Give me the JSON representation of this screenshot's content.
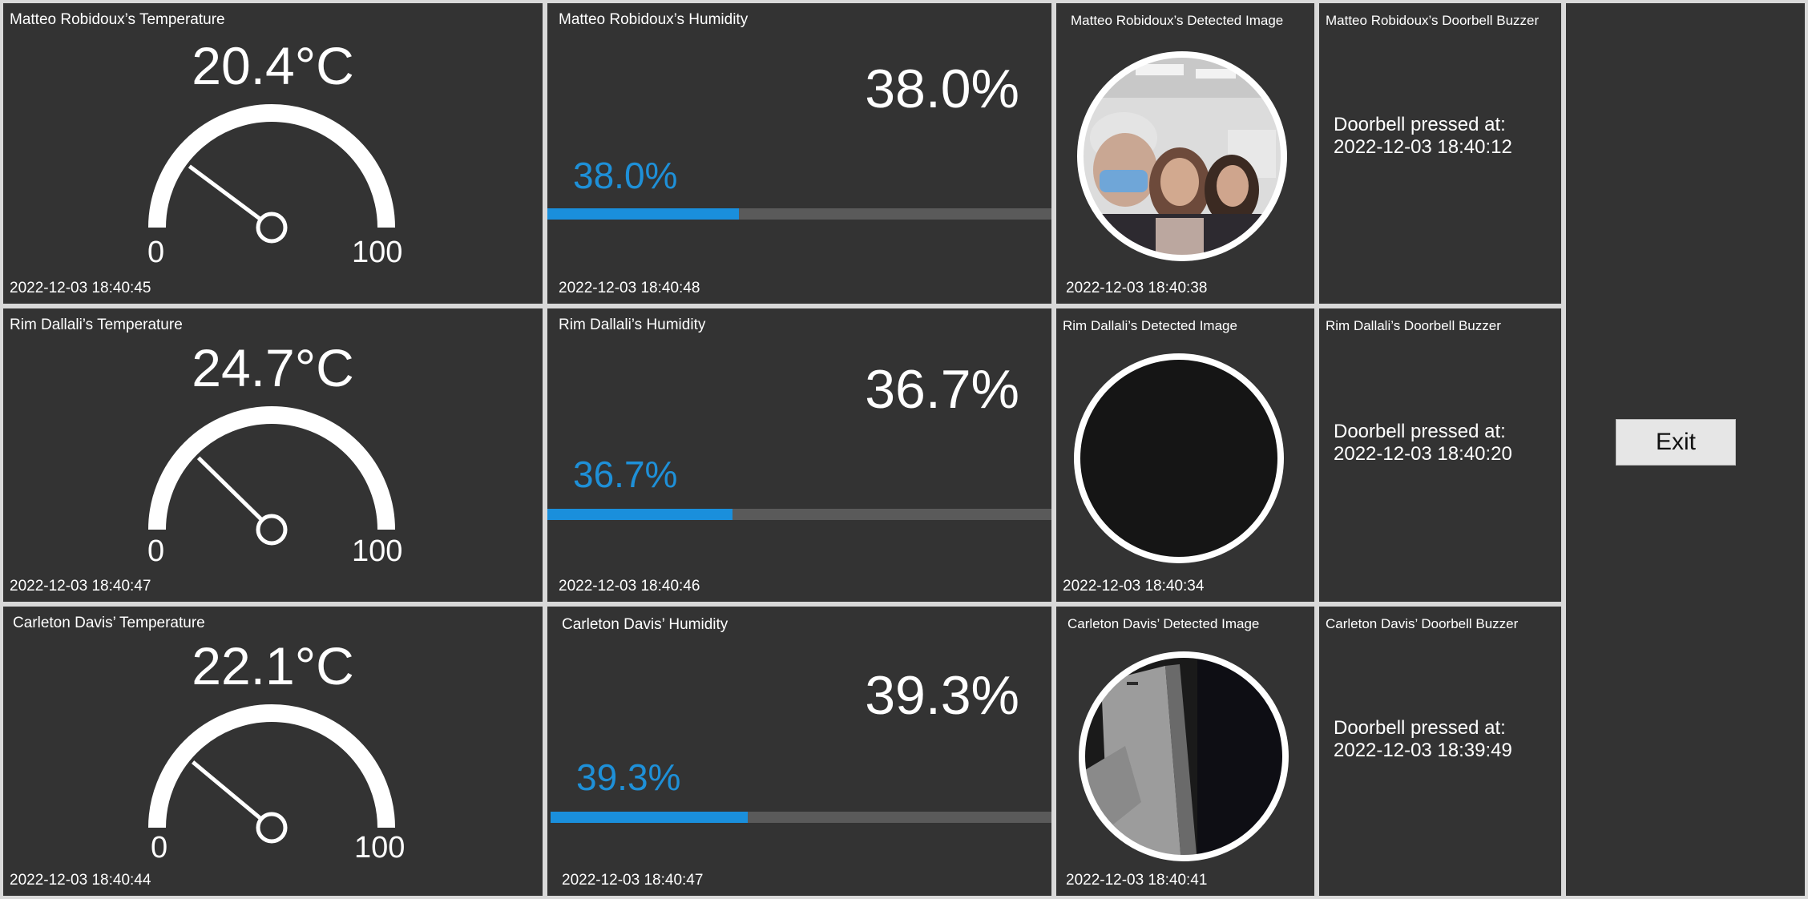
{
  "rows": [
    {
      "temperature": {
        "title": "Matteo Robidoux’s Temperature",
        "value": "20.4°C",
        "reading": 20.4,
        "min": "0",
        "max": "100",
        "timestamp": "2022-12-03 18:40:45"
      },
      "humidity": {
        "title": "Matteo Robidoux’s Humidity",
        "value": "38.0%",
        "bar_label": "38.0%",
        "percent": 38.0,
        "timestamp": "2022-12-03 18:40:48"
      },
      "image": {
        "title": "Matteo Robidoux’s Detected Image",
        "timestamp": "2022-12-03 18:40:38"
      },
      "doorbell": {
        "title": "Matteo Robidoux’s Doorbell Buzzer",
        "line1": "Doorbell pressed at:",
        "line2": "2022-12-03 18:40:12"
      }
    },
    {
      "temperature": {
        "title": "Rim Dallali’s Temperature",
        "value": "24.7°C",
        "reading": 24.7,
        "min": "0",
        "max": "100",
        "timestamp": "2022-12-03 18:40:47"
      },
      "humidity": {
        "title": "Rim Dallali’s Humidity",
        "value": "36.7%",
        "bar_label": "36.7%",
        "percent": 36.7,
        "timestamp": "2022-12-03 18:40:46"
      },
      "image": {
        "title": "Rim Dallali’s Detected Image",
        "timestamp": "2022-12-03 18:40:34"
      },
      "doorbell": {
        "title": "Rim Dallali’s Doorbell Buzzer",
        "line1": "Doorbell pressed at:",
        "line2": "2022-12-03 18:40:20"
      }
    },
    {
      "temperature": {
        "title": "Carleton Davis’ Temperature",
        "value": "22.1°C",
        "reading": 22.1,
        "min": "0",
        "max": "100",
        "timestamp": "2022-12-03 18:40:44"
      },
      "humidity": {
        "title": "Carleton Davis’ Humidity",
        "value": "39.3%",
        "bar_label": "39.3%",
        "percent": 39.3,
        "timestamp": "2022-12-03 18:40:47"
      },
      "image": {
        "title": "Carleton Davis’ Detected Image",
        "timestamp": "2022-12-03 18:40:41"
      },
      "doorbell": {
        "title": "Carleton Davis’ Doorbell Buzzer",
        "line1": "Doorbell pressed at:",
        "line2": "2022-12-03 18:39:49"
      }
    }
  ],
  "exit_label": "Exit",
  "colors": {
    "panel": "#333333",
    "background": "#d9d9d9",
    "accent_blue": "#1a8fdc",
    "track": "#5a5a5a"
  }
}
